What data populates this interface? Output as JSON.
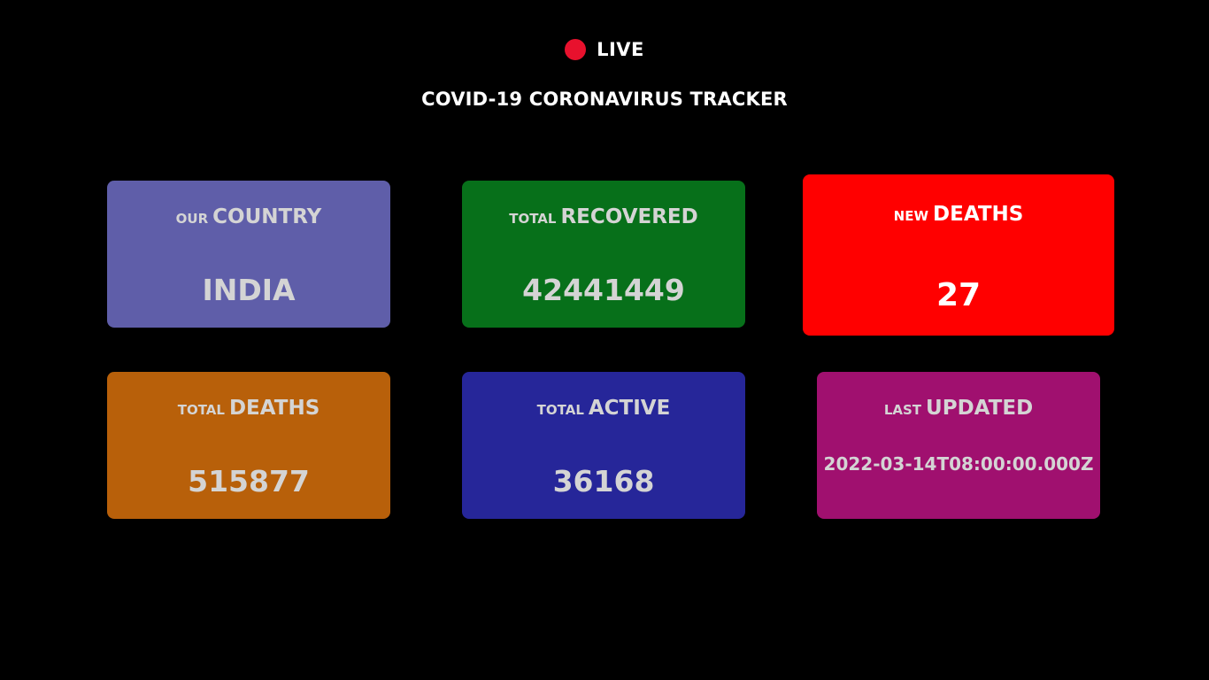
{
  "header": {
    "live_label": "LIVE",
    "title": "COVID-19 CORONAVIRUS TRACKER"
  },
  "colors": {
    "live_dot": "#e8112d",
    "country_card": "#5f5ea9",
    "recovered_card": "#07701a",
    "new_deaths_card": "#ff0000",
    "total_deaths_card": "#b8600a",
    "active_card": "#262699",
    "updated_card": "#a0106f"
  },
  "cards": {
    "country": {
      "prefix": "OUR",
      "label": "COUNTRY",
      "value": "INDIA"
    },
    "recovered": {
      "prefix": "TOTAL",
      "label": "RECOVERED",
      "value": "42441449"
    },
    "new_deaths": {
      "prefix": "NEW",
      "label": "DEATHS",
      "value": "27"
    },
    "total_deaths": {
      "prefix": "TOTAL",
      "label": "DEATHS",
      "value": "515877"
    },
    "active": {
      "prefix": "TOTAL",
      "label": "ACTIVE",
      "value": "36168"
    },
    "last_updated": {
      "prefix": "LAST",
      "label": "UPDATED",
      "value": "2022-03-14T08:00:00.000Z"
    }
  }
}
